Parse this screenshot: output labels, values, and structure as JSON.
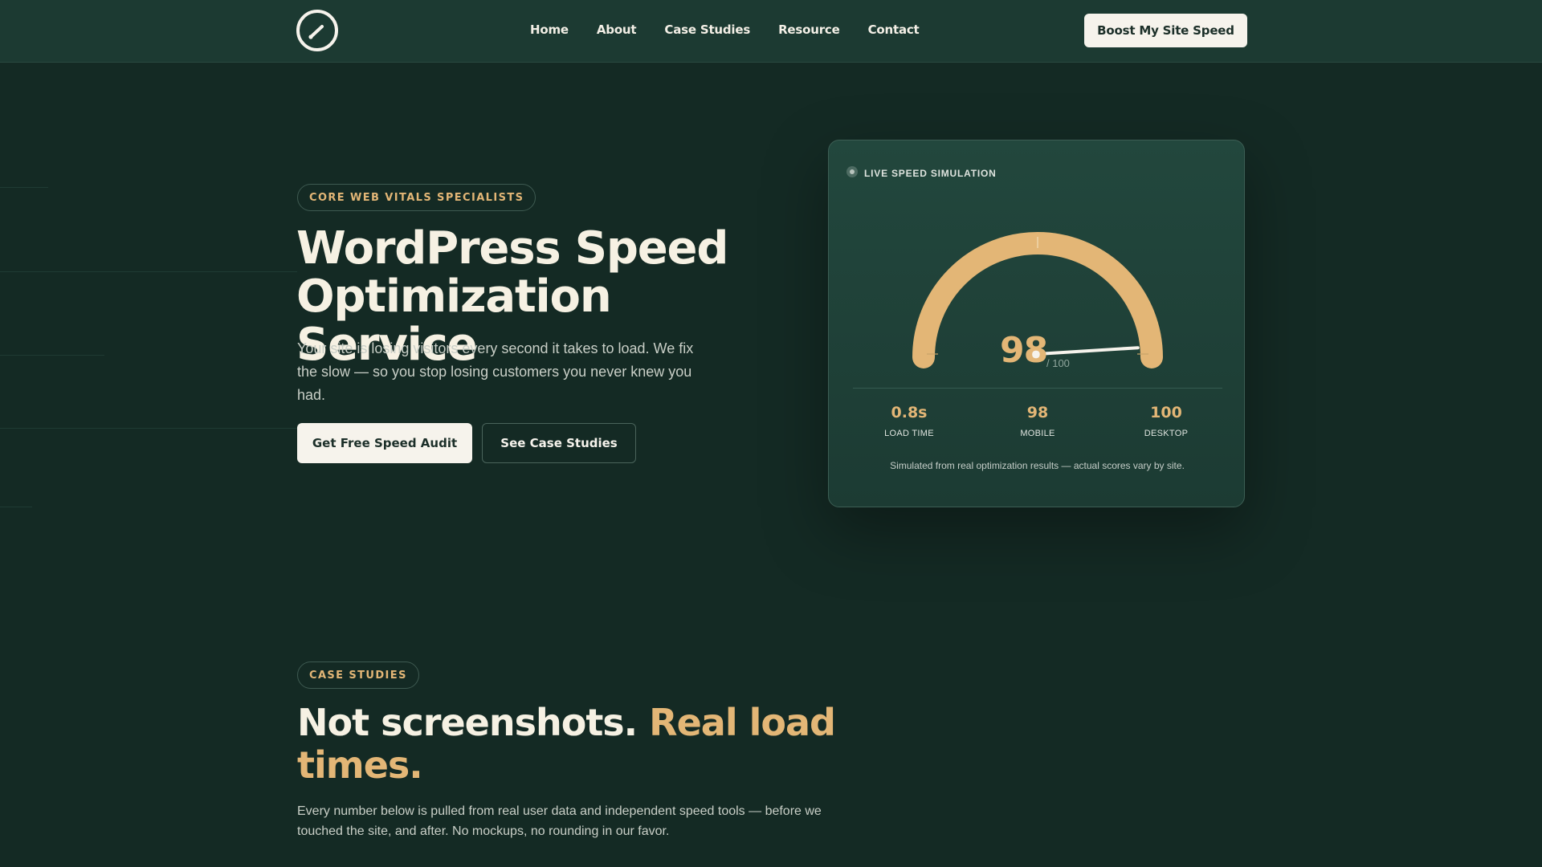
{
  "nav": {
    "links": [
      "Home",
      "About",
      "Case Studies",
      "Resource",
      "Contact"
    ],
    "cta": "Boost My Site Speed"
  },
  "hero": {
    "eyebrow": "CORE WEB VITALS SPECIALISTS",
    "title": "WordPress Speed Optimization Service",
    "subtitle": "Your site is losing visitors every second it takes to load. We fix the slow — so you stop losing customers you never knew you had.",
    "primary_cta": "Get Free Speed Audit",
    "secondary_cta": "See Case Studies"
  },
  "simulation": {
    "label": "LIVE SPEED SIMULATION",
    "score": "98",
    "score_of": "/ 100",
    "score_value": 98,
    "metrics": [
      {
        "value": "0.8s",
        "label": "LOAD TIME"
      },
      {
        "value": "98",
        "label": "MOBILE"
      },
      {
        "value": "100",
        "label": "DESKTOP"
      }
    ],
    "note": "Simulated from real optimization results — actual scores vary by site."
  },
  "case_studies": {
    "eyebrow": "CASE STUDIES",
    "title_main": "Not screenshots.",
    "title_accent": "Real load times.",
    "subtitle": "Every number below is pulled from real user data and independent speed tools — before we touched the site, and after. No mockups, no rounding in our favor."
  },
  "colors": {
    "background": "#142a24",
    "nav_background": "#1c3a32",
    "accent": "#e3b676",
    "text": "#f6f1e3",
    "button_light": "#f6f3ec"
  },
  "icons": {
    "logo": "speedometer-icon",
    "live": "live-dot-icon"
  }
}
